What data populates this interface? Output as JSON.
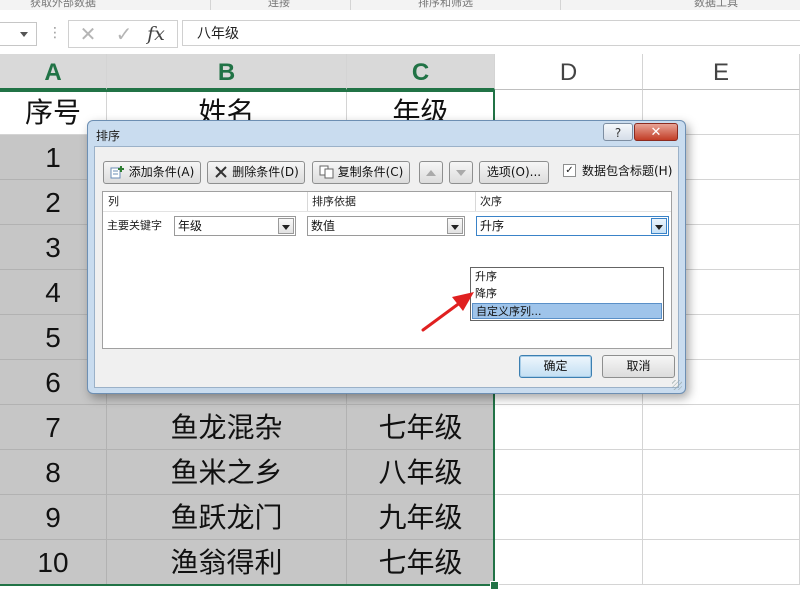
{
  "ribbon": {
    "groups": [
      "获取外部数据",
      "连接",
      "排序和筛选",
      "数据工具"
    ]
  },
  "formula_bar": {
    "content": "八年级",
    "fx_label": "fx",
    "cancel_glyph": "✕",
    "enter_glyph": "✓"
  },
  "columns": [
    "A",
    "B",
    "C",
    "D",
    "E"
  ],
  "header_row": [
    "序号",
    "姓名",
    "年级"
  ],
  "rows": [
    [
      "1",
      "",
      ""
    ],
    [
      "2",
      "",
      ""
    ],
    [
      "3",
      "",
      ""
    ],
    [
      "4",
      "",
      ""
    ],
    [
      "5",
      "",
      ""
    ],
    [
      "6",
      "",
      ""
    ],
    [
      "7",
      "鱼龙混杂",
      "七年级"
    ],
    [
      "8",
      "鱼米之乡",
      "八年级"
    ],
    [
      "9",
      "鱼跃龙门",
      "九年级"
    ],
    [
      "10",
      "渔翁得利",
      "七年级"
    ]
  ],
  "dialog": {
    "title": "排序",
    "help_label": "?",
    "close_label": "✕",
    "toolbar": {
      "add_level": "添加条件(A)",
      "delete_level": "删除条件(D)",
      "copy_level": "复制条件(C)",
      "options": "选项(O)...",
      "has_headers_label": "数据包含标题(H)",
      "has_headers_checked": true
    },
    "list_headers": {
      "column": "列",
      "sort_on": "排序依据",
      "order": "次序"
    },
    "level": {
      "label": "主要关键字",
      "column_value": "年级",
      "sort_on_value": "数值",
      "order_value": "升序"
    },
    "order_options": [
      "升序",
      "降序",
      "自定义序列..."
    ],
    "order_highlighted": "自定义序列...",
    "ok": "确定",
    "cancel": "取消"
  },
  "colors": {
    "excel_green": "#217346",
    "selection_fill": "#c6c6c6",
    "dialog_frame": "#c9dcef",
    "annotation_arrow": "#e02020"
  }
}
